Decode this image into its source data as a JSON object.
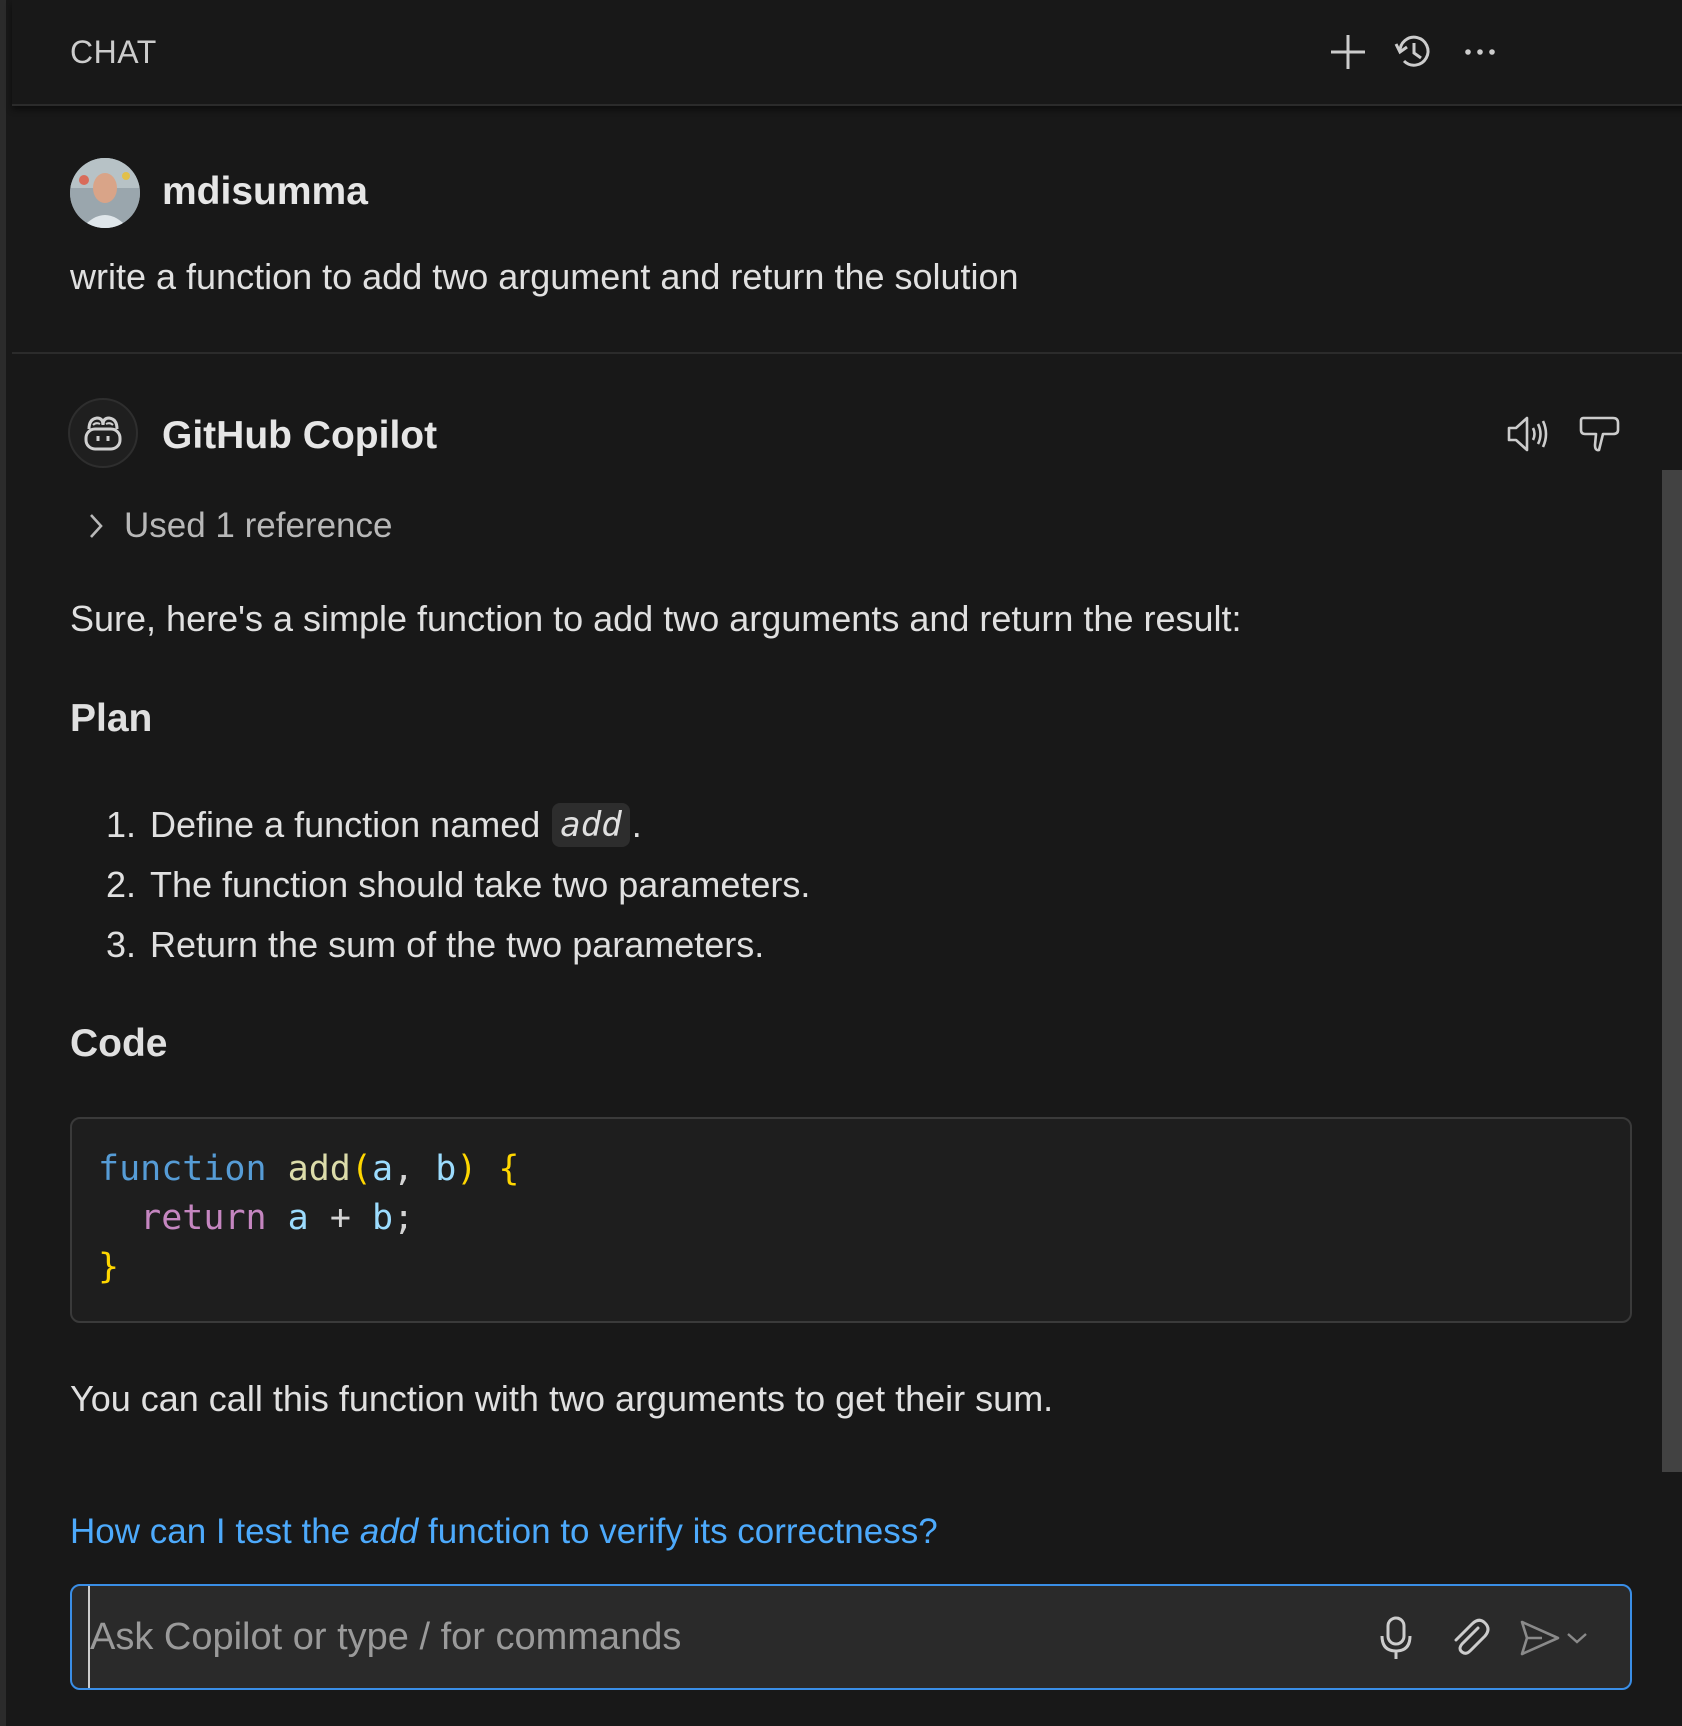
{
  "header": {
    "title": "CHAT",
    "icons": [
      "plus-icon",
      "history-icon",
      "more-icon"
    ]
  },
  "user_message": {
    "username": "mdisumma",
    "text": "write a function to add two argument and return the solution"
  },
  "response": {
    "author": "GitHub Copilot",
    "references": "Used 1 reference",
    "intro": "Sure, here's a simple function to add two arguments and return the result:",
    "plan_heading": "Plan",
    "plan": [
      {
        "num": "1.",
        "before": "Define a function named ",
        "code": "add",
        "after": "."
      },
      {
        "num": "2.",
        "before": "The function should take two parameters.",
        "code": "",
        "after": ""
      },
      {
        "num": "3.",
        "before": "Return the sum of the two parameters.",
        "code": "",
        "after": ""
      }
    ],
    "code_heading": "Code",
    "code": {
      "line1": {
        "kw": "function",
        "fn": "add",
        "open": "(",
        "a": "a",
        "comma": ", ",
        "b": "b",
        "close": ")",
        "brace": "{"
      },
      "line2": {
        "ret": "return",
        "a": "a",
        "op": "+",
        "b": "b",
        "semi": ";"
      },
      "line3": {
        "brace": "}"
      }
    },
    "outro": "You can call this function with two arguments to get their sum."
  },
  "followup": {
    "before": "How can I test the ",
    "emph": "add",
    "after": " function to verify its correctness?"
  },
  "input": {
    "placeholder": "Ask Copilot or type / for commands",
    "value": ""
  },
  "colors": {
    "background": "#181818",
    "accent_border": "#3a8ee6",
    "link": "#4daafc",
    "keyword": "#569cd6",
    "function_name": "#dcdcaa",
    "parameter": "#9cdcfe",
    "bracket": "#ffd700",
    "return_keyword": "#c586c0"
  }
}
